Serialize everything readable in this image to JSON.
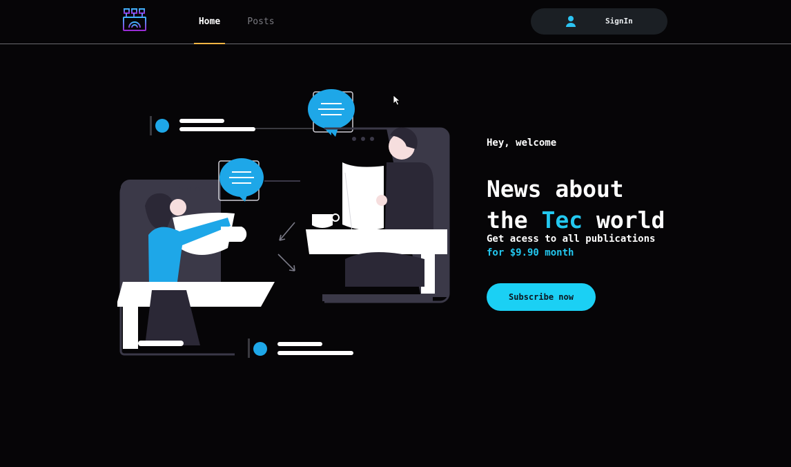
{
  "header": {
    "logo_icon": "laptop-network-logo-icon",
    "nav": [
      {
        "label": "Home",
        "active": true
      },
      {
        "label": "Posts",
        "active": false
      }
    ],
    "signin": {
      "label": "SignIn",
      "icon": "user-icon"
    }
  },
  "hero": {
    "greeting": "Hey, welcome",
    "headline_part1": "News about",
    "headline_part2": "the",
    "headline_accent": "Tec",
    "headline_part3": "world",
    "offer_line1": "Get acess to all publications",
    "offer_line2": "for $9.90 month",
    "cta_label": "Subscribe now"
  },
  "colors": {
    "background": "#060507",
    "accent": "#23c8f0",
    "cta": "#1bd0f4",
    "active_tab_underline": "#f2b544",
    "signin_bg": "#1b1f24"
  }
}
